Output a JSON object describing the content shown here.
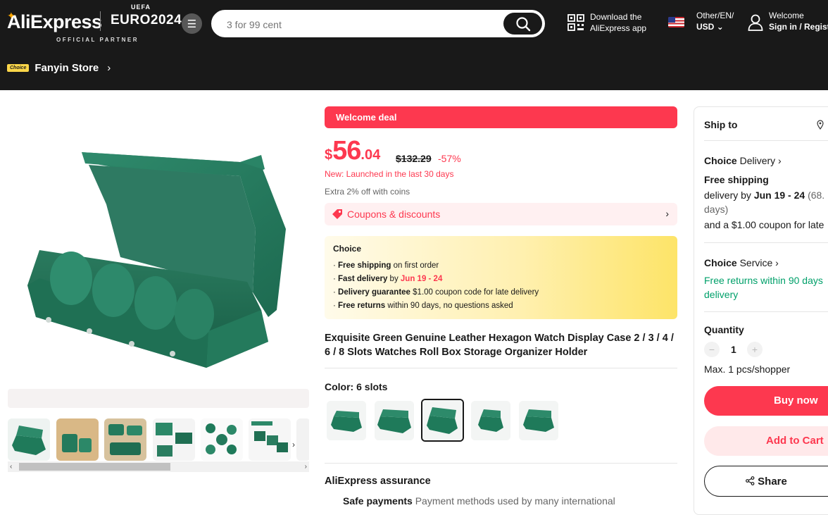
{
  "header": {
    "logo": "AliExpress",
    "euro_text": "EURO2024",
    "uefa_text": "UEFA",
    "partner_text": "OFFICIAL PARTNER",
    "search_placeholder": "3 for 99 cent",
    "download_line1": "Download the",
    "download_line2": "AliExpress app",
    "locale_line1": "Other/EN/",
    "locale_line2": "USD",
    "welcome_line1": "Welcome",
    "welcome_line2": "Sign in / Regist"
  },
  "store": {
    "choice_tag": "Choice",
    "name": "Fanyin Store"
  },
  "product": {
    "welcome_deal": "Welcome deal",
    "price_currency": "$",
    "price_int": "56",
    "price_dec": ".04",
    "original_price": "$132.29",
    "discount": "-57%",
    "new_launch": "New: Launched in the last 30 days",
    "coins": "Extra 2% off with coins",
    "coupons": "Coupons & discounts",
    "choice_title": "Choice",
    "choice_lines": [
      {
        "bold": "Free shipping",
        "rest": " on first order"
      },
      {
        "bold": "Fast delivery",
        "mid": " by ",
        "red": "Jun 19 - 24"
      },
      {
        "bold": "Delivery guarantee",
        "rest": "  $1.00 coupon code for late delivery"
      },
      {
        "bold": "Free returns",
        "rest": "  within 90 days, no questions asked"
      }
    ],
    "title": "Exquisite Green Genuine Leather Hexagon Watch Display Case 2 / 3 / 4 / 6 / 8 Slots Watches Roll Box Storage Organizer Holder",
    "color_label": "Color: 6 slots",
    "assurance": "AliExpress assurance",
    "safe_payments": "Safe payments",
    "safe_payments_desc": "Payment methods used by many international"
  },
  "sidebar": {
    "ship_to": "Ship to",
    "choice_delivery_bold": "Choice",
    "choice_delivery_rest": " Delivery",
    "free_shipping": "Free shipping",
    "delivery_prefix": "delivery by ",
    "delivery_date": "Jun 19 - 24",
    "delivery_suffix": " (68.",
    "delivery_line2": "days)",
    "coupon_line": "and a $1.00 coupon for late",
    "choice_service_bold": "Choice",
    "choice_service_rest": " Service",
    "free_returns_line1": "Free returns within 90 days",
    "free_returns_line2": "delivery",
    "quantity_label": "Quantity",
    "quantity_value": "1",
    "max_text": "Max. 1 pcs/shopper",
    "buy_now": "Buy now",
    "add_to_cart": "Add to Cart",
    "share": "Share"
  },
  "colors": {
    "accent": "#fd384f",
    "header_bg": "#191919",
    "green": "#00a06a"
  }
}
